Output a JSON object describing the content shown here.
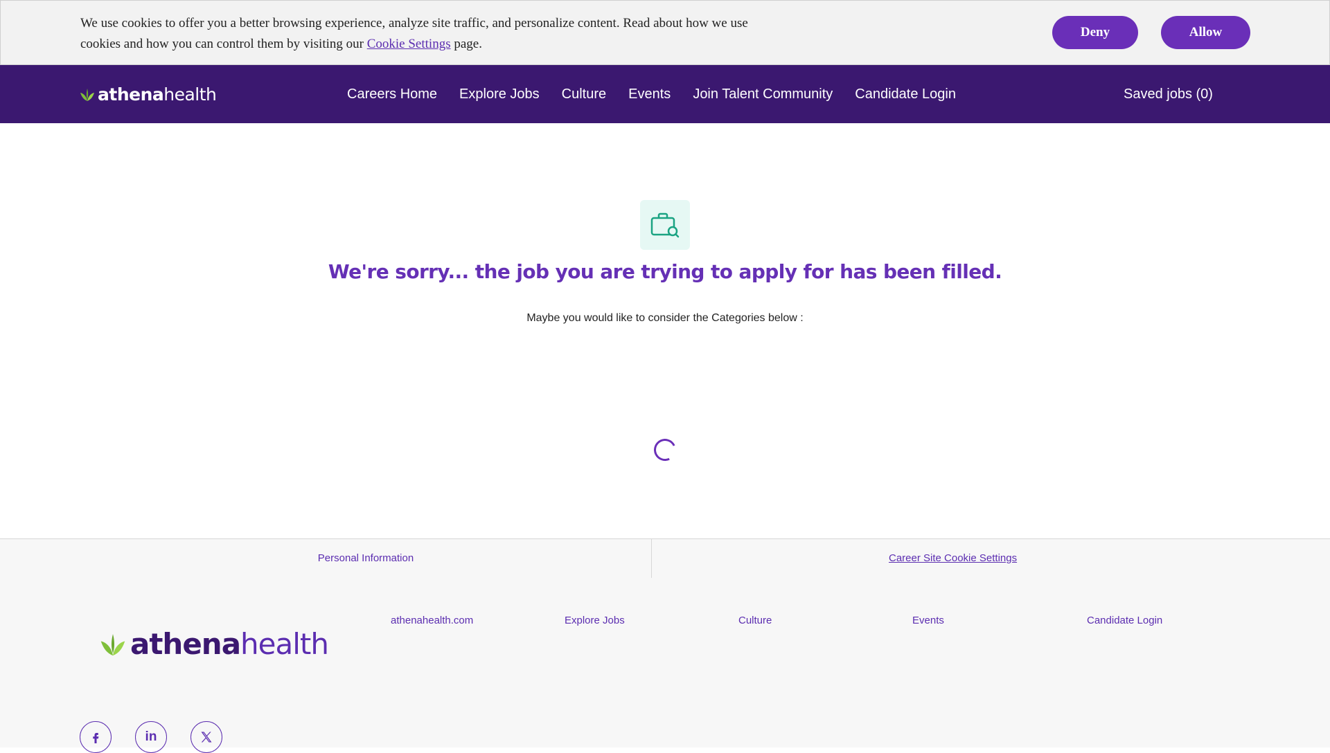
{
  "cookie_banner": {
    "text_before": "We use cookies to offer you a better browsing experience, analyze site traffic, and personalize content. Read about how we use cookies and how you can control them by visiting our ",
    "link": "Cookie Settings",
    "text_after": " page.",
    "deny_label": "Deny",
    "allow_label": "Allow"
  },
  "header": {
    "logo_icon": "leaf-icon",
    "logo_text_a": "athena",
    "logo_text_b": "health",
    "nav": [
      "Careers Home",
      "Explore Jobs",
      "Culture",
      "Events",
      "Join Talent Community",
      "Candidate Login"
    ],
    "saved_jobs": "Saved jobs (0)"
  },
  "main": {
    "icon": "briefcase-search-icon",
    "title": "We're sorry... the job you are trying to apply for has been filled.",
    "subtitle": "Maybe you would like to consider the Categories below :"
  },
  "footer_bar": {
    "personal_info": "Personal Information",
    "cookie_settings": "Career Site Cookie Settings"
  },
  "footer": {
    "logo_text_a": "athena",
    "logo_text_b": "health",
    "links": [
      "athenahealth.com",
      "Explore Jobs",
      "Culture",
      "Events",
      "Candidate Login"
    ],
    "social": [
      "facebook-icon",
      "linkedin-icon",
      "x-icon"
    ]
  },
  "colors": {
    "brand_purple": "#6a2fb8",
    "nav_dark_purple": "#3b1870",
    "leaf_green": "#7fbf3a",
    "icon_teal": "#1aa382"
  }
}
